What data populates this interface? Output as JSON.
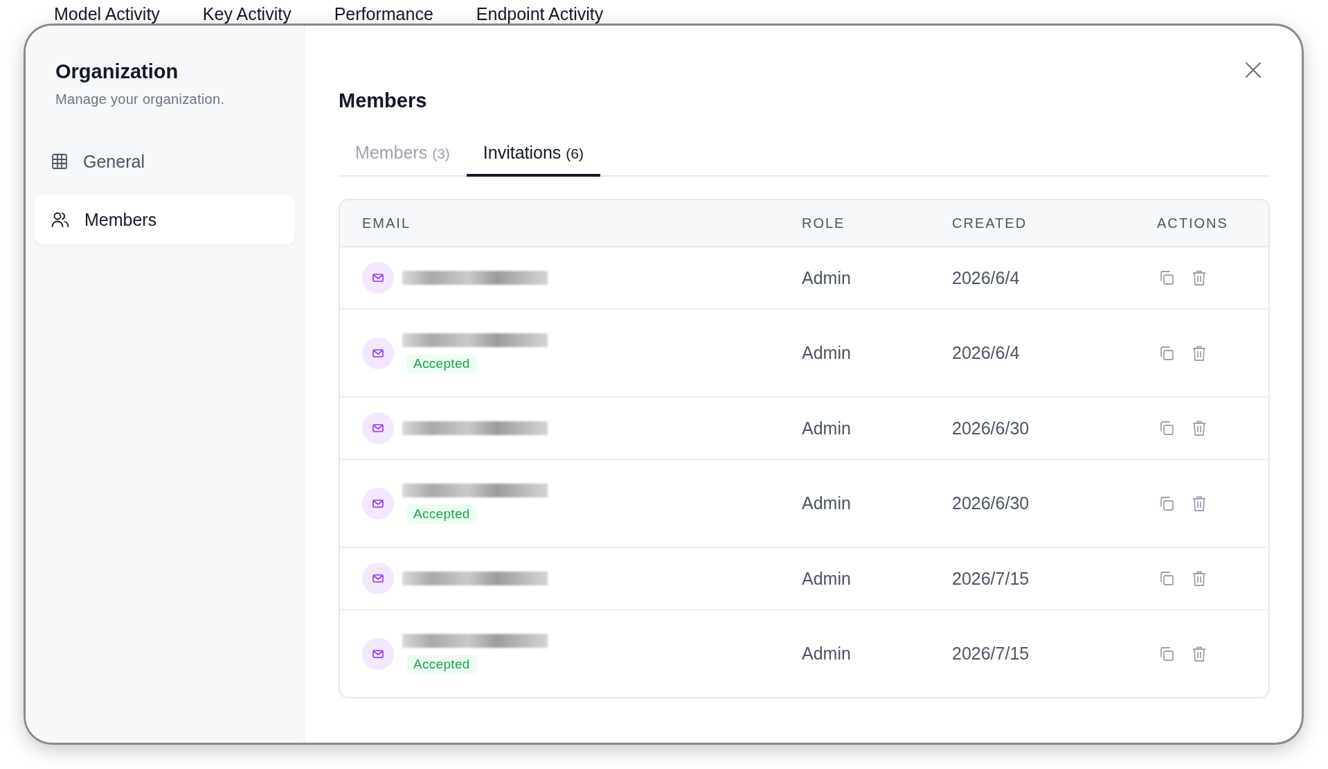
{
  "background_tabs": [
    "Model Activity",
    "Key Activity",
    "Performance",
    "Endpoint Activity"
  ],
  "sidebar": {
    "title": "Organization",
    "subtitle": "Manage your organization.",
    "items": [
      {
        "label": "General",
        "kind": "grid",
        "selected": false
      },
      {
        "label": "Members",
        "kind": "users",
        "selected": true
      }
    ]
  },
  "main": {
    "title": "Members",
    "tabs": [
      {
        "label": "Members",
        "count": "(3)",
        "selected": false
      },
      {
        "label": "Invitations",
        "count": "(6)",
        "selected": true
      }
    ],
    "table": {
      "columns": [
        "EMAIL",
        "ROLE",
        "CREATED",
        "ACTIONS"
      ],
      "rows": [
        {
          "role": "Admin",
          "created": "2026/6/4"
        },
        {
          "status": "Accepted",
          "role": "Admin",
          "created": "2026/6/4"
        },
        {
          "role": "Admin",
          "created": "2026/6/30"
        },
        {
          "status": "Accepted",
          "role": "Admin",
          "created": "2026/6/30"
        },
        {
          "role": "Admin",
          "created": "2026/7/15"
        },
        {
          "status": "Accepted",
          "role": "Admin",
          "created": "2026/7/15"
        }
      ]
    }
  }
}
